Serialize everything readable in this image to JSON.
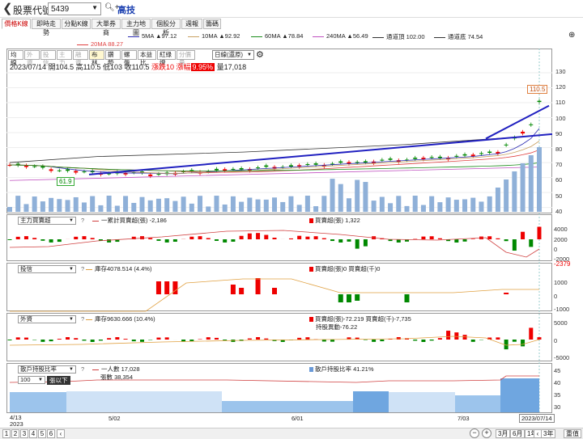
{
  "topbar": {
    "title": "股票代號",
    "code": "5439",
    "name": "高技"
  },
  "tabs": [
    "價格K線",
    "即時走勢",
    "分點K線",
    "大單券商",
    "主力地圖",
    "個股分析",
    "週報",
    "籌碼"
  ],
  "ma_legend": [
    {
      "label": "5MA ▲97.12",
      "color": "#2a2ab0"
    },
    {
      "label": "10MA ▲92.92",
      "color": "#c8a060"
    },
    {
      "label": "60MA ▲78.84",
      "color": "#1a8c1a"
    },
    {
      "label": "240MA ▲56.49",
      "color": "#c050c0"
    },
    {
      "label": "通道頂 102.00",
      "color": "#333333"
    },
    {
      "label": "通道底 74.54",
      "color": "#333333"
    },
    {
      "label": "20MA 88.27",
      "color": "#e04040"
    }
  ],
  "chart_tabs": [
    "均線",
    "外資",
    "投信",
    "主力",
    "融資",
    "布林",
    "鑽勢",
    "螺盤",
    "本益比",
    "紅綠燈",
    "分價量"
  ],
  "period": "日線(還原)",
  "quote": {
    "date": "2023/07/14",
    "open_l": "開",
    "open": "104.5",
    "high_l": "高",
    "high": "110.5",
    "low_l": "低",
    "low": "103",
    "close_l": "收",
    "close": "110.5",
    "chg_l": "漲跌",
    "chg": "10",
    "pct_l": "漲幅",
    "pct": "9.95%",
    "vol_l": "量",
    "vol": "17,018"
  },
  "price_axis": [
    "130",
    "120",
    "110",
    "100",
    "90",
    "80",
    "70",
    "60",
    "50",
    "40"
  ],
  "price_labels": {
    "high": "110.5",
    "low": "61.9"
  },
  "panels": {
    "main": {
      "select": "主力買賣超",
      "line": "一累計買賣超(張) -2,186",
      "bar": "買賣超(張) 1,322",
      "axis": [
        "4000",
        "2000",
        "0",
        "-2000"
      ]
    },
    "trust": {
      "select": "投信",
      "line": "庫存4078.514 (4.4%)",
      "bar": "買賣超(張)0 買賣超(千)0",
      "axis": [
        "1000",
        "0",
        "-1000"
      ],
      "extra": "-2379"
    },
    "foreign": {
      "select": "外資",
      "line": "庫存9630.666 (10.4%)",
      "bar": "買賣超(張)-72.219 買賣超(千)-7,735",
      "bar2": "持股異動-76.22",
      "axis": [
        "5000",
        "0",
        "-5000"
      ]
    },
    "holders": {
      "select": "散戶持股比率",
      "select2": "100",
      "below": "張以下",
      "line1": "一人數 17,028",
      "line2": "張數 38,354",
      "bar": "散戶持股比率 41.21%",
      "axis": [
        "45",
        "40",
        "35",
        "30"
      ]
    }
  },
  "x_axis": [
    {
      "label": "4/13",
      "sub": "2023"
    },
    {
      "label": "5/02"
    },
    {
      "label": "6/01"
    },
    {
      "label": "7/03"
    }
  ],
  "cursor_date": "2023/07/14",
  "bottom": {
    "pages": [
      "1",
      "2",
      "3",
      "4",
      "5",
      "6"
    ],
    "ranges": [
      "3月",
      "6月",
      "1年",
      "3年",
      "重值"
    ]
  }
}
